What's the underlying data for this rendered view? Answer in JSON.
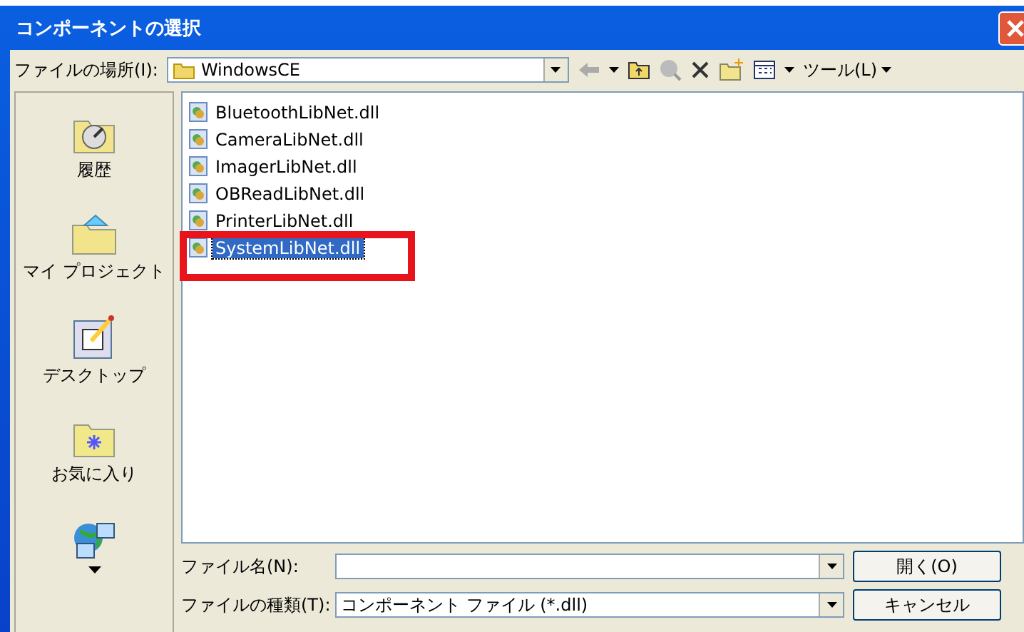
{
  "window": {
    "title": "コンポーネントの選択"
  },
  "location": {
    "label": "ファイルの場所(I):",
    "value": "WindowsCE",
    "tools_label": "ツール(L)"
  },
  "places": [
    {
      "kind": "history",
      "label": "履歴"
    },
    {
      "kind": "project",
      "label": "マイ プロジェクト"
    },
    {
      "kind": "desktop",
      "label": "デスクトップ"
    },
    {
      "kind": "favorites",
      "label": "お気に入り"
    },
    {
      "kind": "network"
    }
  ],
  "files": [
    {
      "name": "BluetoothLibNet.dll",
      "selected": false
    },
    {
      "name": "CameraLibNet.dll",
      "selected": false
    },
    {
      "name": "ImagerLibNet.dll",
      "selected": false
    },
    {
      "name": "OBReadLibNet.dll",
      "selected": false
    },
    {
      "name": "PrinterLibNet.dll",
      "selected": false
    },
    {
      "name": "SystemLibNet.dll",
      "selected": true
    }
  ],
  "filename": {
    "label": "ファイル名(N):"
  },
  "filetype": {
    "label": "ファイルの種類(T):",
    "value": "コンポーネント ファイル (*.dll)"
  },
  "buttons": [
    "開く(O)",
    "キャンセル"
  ]
}
